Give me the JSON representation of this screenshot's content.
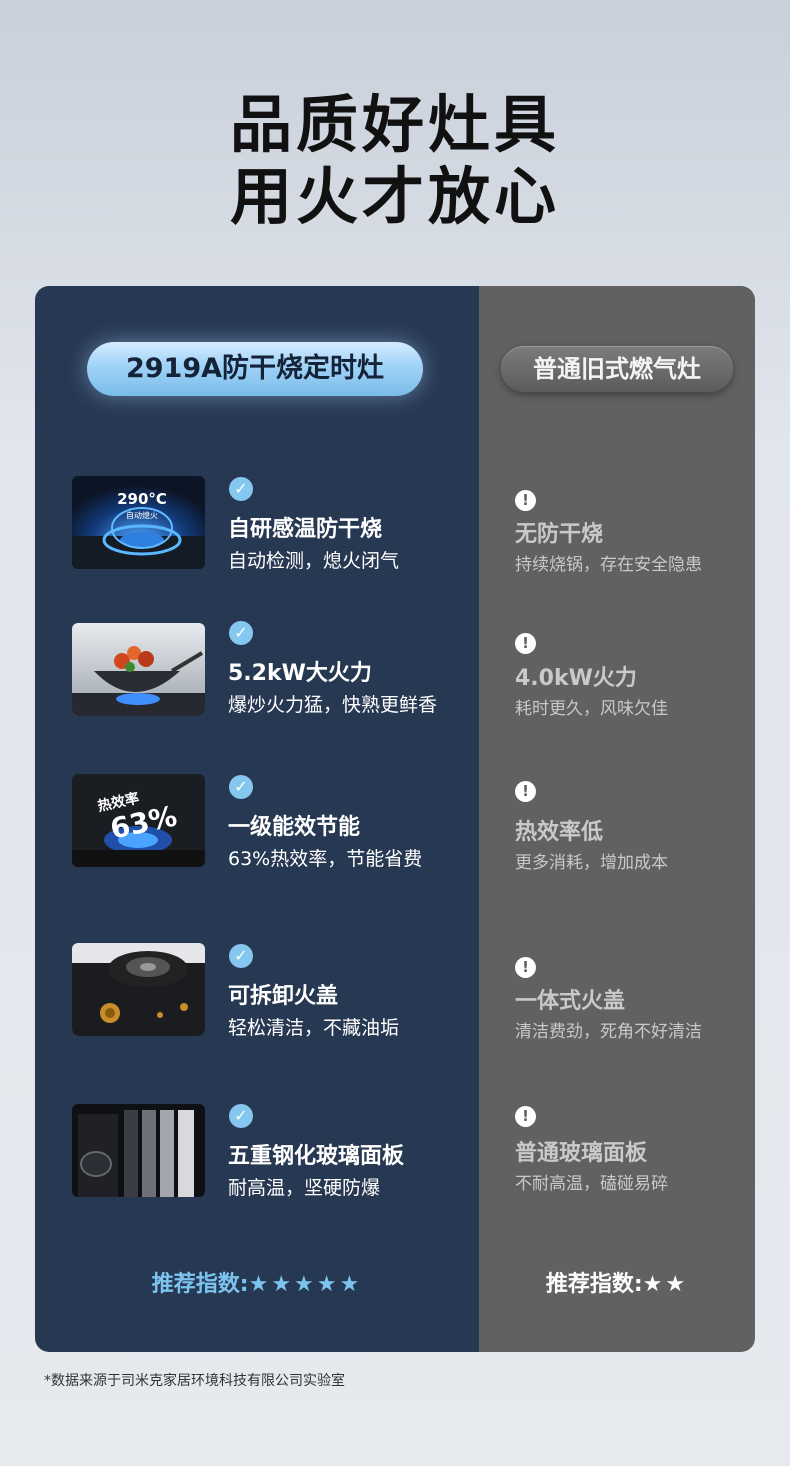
{
  "headline": {
    "line1": "品质好灶具",
    "line2": "用火才放心"
  },
  "left": {
    "title": "2919A防干烧定时灶",
    "features": [
      {
        "title": "自研感温防干烧",
        "subtitle": "自动检测，熄火闭气",
        "image": "stove-burner-sensor",
        "overlay_temp": "290°C",
        "overlay_caption": "自动熄火"
      },
      {
        "title": "5.2kW大火力",
        "subtitle": "爆炒火力猛，快熟更鲜香",
        "image": "wok-stir-fry"
      },
      {
        "title": "一级能效节能",
        "subtitle": "63%热效率，节能省费",
        "image": "burner-efficiency",
        "overlay_label": "热效率",
        "overlay_value": "63%"
      },
      {
        "title": "可拆卸火盖",
        "subtitle": "轻松清洁，不藏油垢",
        "image": "removable-burner-cap"
      },
      {
        "title": "五重钢化玻璃面板",
        "subtitle": "耐高温，坚硬防爆",
        "image": "glass-panel-layers"
      }
    ],
    "score_label": "推荐指数:",
    "stars": "★★★★★",
    "star_count": 5
  },
  "right": {
    "title": "普通旧式燃气灶",
    "features": [
      {
        "title": "无防干烧",
        "subtitle": "持续烧锅，存在安全隐患"
      },
      {
        "title": "4.0kW火力",
        "subtitle": "耗时更久，风味欠佳"
      },
      {
        "title": "热效率低",
        "subtitle": "更多消耗，增加成本"
      },
      {
        "title": "一体式火盖",
        "subtitle": "清洁费劲，死角不好清洁"
      },
      {
        "title": "普通玻璃面板",
        "subtitle": "不耐高温，磕碰易碎"
      }
    ],
    "score_label": "推荐指数:",
    "stars": "★★",
    "star_count": 2
  },
  "footnote": "*数据来源于司米克家居环境科技有限公司实验室",
  "colors": {
    "left_bg": "#273852",
    "right_bg": "#616161",
    "accent": "#7cc4ef",
    "check": "#86c7f0"
  },
  "icons": {
    "left_item": "check-circle-icon",
    "right_item": "exclamation-circle-icon"
  }
}
